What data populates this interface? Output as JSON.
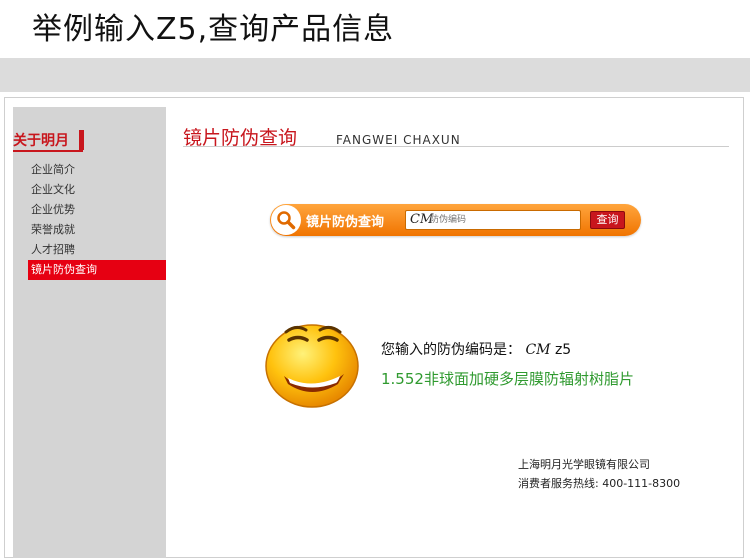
{
  "heading": "举例输入Z5,查询产品信息",
  "sidebar": {
    "title": "关于明月",
    "items": [
      {
        "label": "企业简介",
        "active": false
      },
      {
        "label": "企业文化",
        "active": false
      },
      {
        "label": "企业优势",
        "active": false
      },
      {
        "label": "荣誉成就",
        "active": false
      },
      {
        "label": "人才招聘",
        "active": false
      },
      {
        "label": "镜片防伪查询",
        "active": true
      }
    ]
  },
  "main": {
    "title": "镜片防伪查询",
    "title_en": "FANGWEI CHAXUN"
  },
  "search": {
    "label": "镜片防伪查询",
    "logo": "CM",
    "placeholder": "防伪编码",
    "button": "查询",
    "icon": "search-icon"
  },
  "result": {
    "prefix": "您输入的防伪编码是：",
    "logo": "CM",
    "code": "z5",
    "product": "1.552非球面加硬多层膜防辐射树脂片",
    "icon": "smiley-face-icon"
  },
  "footer": {
    "company": "上海明月光学眼镜有限公司",
    "hotline": "消费者服务热线: 400-111-8300"
  },
  "colors": {
    "accent_red": "#c8161d",
    "search_orange": "#f07400",
    "product_green": "#2f9a2f",
    "sidebar_gray": "#d4d4d4"
  }
}
